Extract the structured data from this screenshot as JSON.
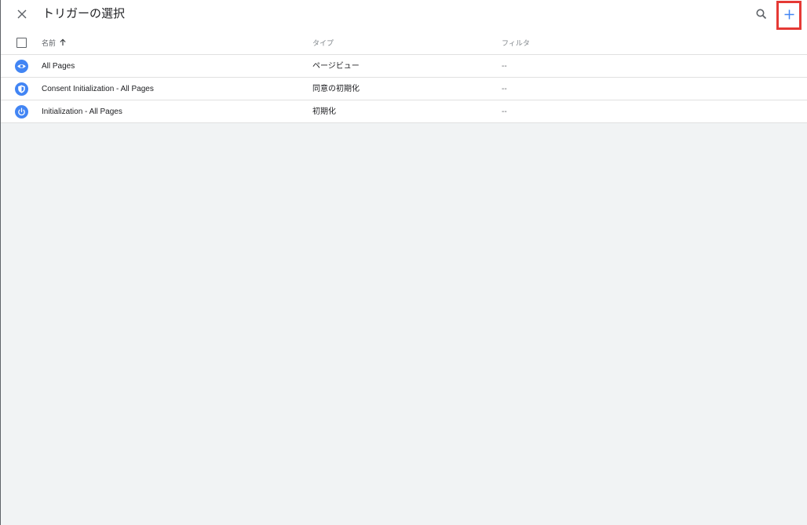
{
  "dialog": {
    "title": "トリガーの選択"
  },
  "table": {
    "columns": {
      "name": "名前",
      "type": "タイプ",
      "filter": "フィルタ"
    },
    "sort": "ascending",
    "rows": [
      {
        "name": "All Pages",
        "type": "ページビュー",
        "filter": "--",
        "icon": "eye-icon"
      },
      {
        "name": "Consent Initialization - All Pages",
        "type": "同意の初期化",
        "filter": "--",
        "icon": "shield-icon"
      },
      {
        "name": "Initialization - All Pages",
        "type": "初期化",
        "filter": "--",
        "icon": "power-icon"
      }
    ]
  },
  "colors": {
    "accent": "#4285f4",
    "highlight": "#e53935",
    "background": "#f1f3f4"
  }
}
